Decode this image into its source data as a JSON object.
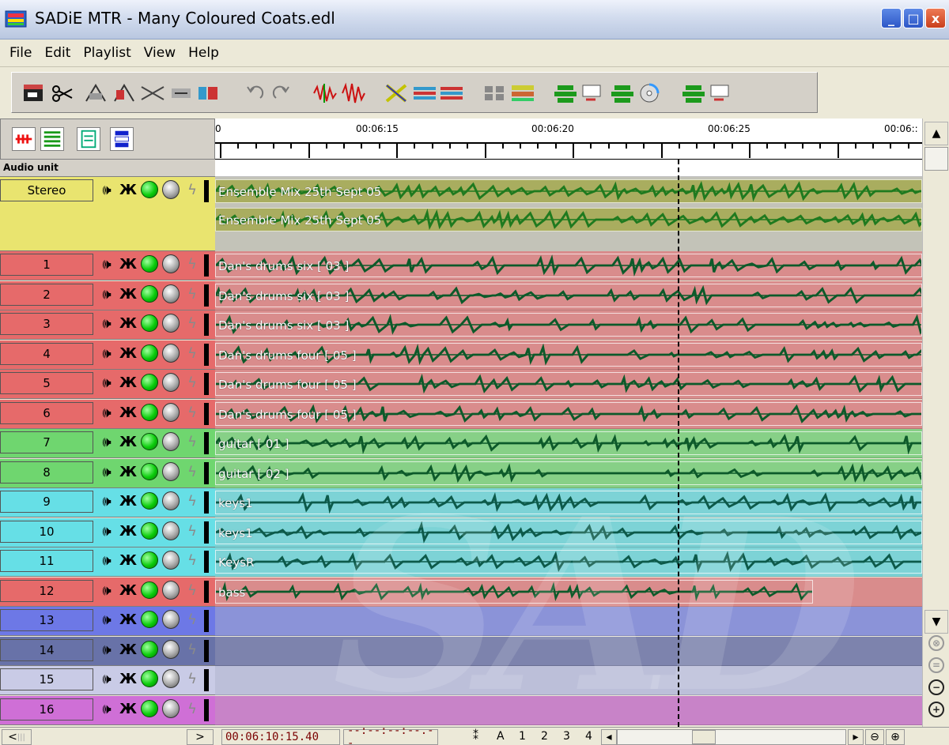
{
  "window": {
    "title": "SADiE MTR - Many Coloured Coats.edl",
    "minimize": "_",
    "maximize": "□",
    "close": "x"
  },
  "menu": [
    "File",
    "Edit",
    "Playlist",
    "View",
    "Help"
  ],
  "ruler": {
    "labels": [
      "00:06:15",
      "00:06:20",
      "00:06:25",
      "00:06::"
    ],
    "left_stub": "0"
  },
  "audio_unit_label": "Audio unit",
  "stereo": {
    "name": "Stereo",
    "color": "#e9e46f",
    "clips": [
      "Ensemble Mix 25th Sept 05",
      "Ensemble Mix 25th Sept 05"
    ]
  },
  "tracks": [
    {
      "name": "1",
      "color": "#e66a6a",
      "lane": "#d98c8c",
      "clip": "Dan's drums six [ 03 ]"
    },
    {
      "name": "2",
      "color": "#e66a6a",
      "lane": "#d98c8c",
      "clip": "Dan's drums six [ 03 ]"
    },
    {
      "name": "3",
      "color": "#e66a6a",
      "lane": "#d98c8c",
      "clip": "Dan's drums six [ 03 ]"
    },
    {
      "name": "4",
      "color": "#e66a6a",
      "lane": "#d98c8c",
      "clip": "Dan's drums four [ 05 ]"
    },
    {
      "name": "5",
      "color": "#e66a6a",
      "lane": "#d98c8c",
      "clip": "Dan's drums four [ 05 ]"
    },
    {
      "name": "6",
      "color": "#e66a6a",
      "lane": "#d98c8c",
      "clip": "Dan's drums four [ 05 ]"
    },
    {
      "name": "7",
      "color": "#6fd66f",
      "lane": "#87d087",
      "clip": "guitar [ 01 ]"
    },
    {
      "name": "8",
      "color": "#6fd66f",
      "lane": "#87d087",
      "clip": "guitar [ 02 ]"
    },
    {
      "name": "9",
      "color": "#66dfe6",
      "lane": "#7dd3d6",
      "clip": "keys1"
    },
    {
      "name": "10",
      "color": "#66dfe6",
      "lane": "#7dd3d6",
      "clip": "keys1"
    },
    {
      "name": "11",
      "color": "#66dfe6",
      "lane": "#7dd3d6",
      "clip": "KeysR"
    },
    {
      "name": "12",
      "color": "#e66a6a",
      "lane": "#d98c8c",
      "clip": "bass"
    },
    {
      "name": "13",
      "color": "#6d78e6",
      "lane": "#8b93d8",
      "clip": ""
    },
    {
      "name": "14",
      "color": "#6872a8",
      "lane": "#7d83ad",
      "clip": ""
    },
    {
      "name": "15",
      "color": "#c9cbe6",
      "lane": "#bcbfd9",
      "clip": ""
    },
    {
      "name": "16",
      "color": "#cf6fd6",
      "lane": "#c883c8",
      "clip": ""
    }
  ],
  "watermark": "SAD",
  "status": {
    "timecode": "00:06:10:15.40",
    "secondary": "--:--:--:--.--",
    "marker_labels": [
      "A",
      "1",
      "2",
      "3",
      "4"
    ]
  }
}
